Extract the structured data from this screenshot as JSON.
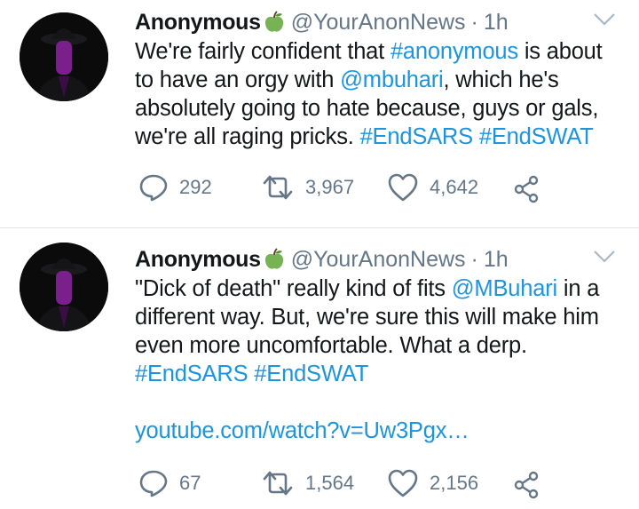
{
  "tweets": [
    {
      "author": "Anonymous",
      "handle": "@YourAnonNews",
      "separator": "·",
      "time": "1h",
      "text": [
        {
          "t": "We're fairly confident that ",
          "link": false
        },
        {
          "t": "#anonymous",
          "link": true
        },
        {
          "t": " is about to have an orgy with ",
          "link": false
        },
        {
          "t": "@mbuhari",
          "link": true
        },
        {
          "t": ", which he's absolutely going to hate because, guys or gals, we're all raging pricks. ",
          "link": false
        },
        {
          "t": "#EndSARS",
          "link": true
        },
        {
          "t": " ",
          "link": false
        },
        {
          "t": "#EndSWAT",
          "link": true
        }
      ],
      "replies": "292",
      "retweets": "3,967",
      "likes": "4,642"
    },
    {
      "author": "Anonymous",
      "handle": "@YourAnonNews",
      "separator": "·",
      "time": "1h",
      "text": [
        {
          "t": "\"Dick of death\" really kind of fits ",
          "link": false
        },
        {
          "t": "@MBuhari",
          "link": true
        },
        {
          "t": " in a different way. But, we're sure this will make him even more uncomfortable. What a derp.",
          "link": false
        },
        {
          "br": true
        },
        {
          "t": "#EndSARS",
          "link": true
        },
        {
          "t": " ",
          "link": false
        },
        {
          "t": "#EndSWAT",
          "link": true
        },
        {
          "br": true
        },
        {
          "br": true
        },
        {
          "t": "youtube.com/watch?v=Uw3Pgx…",
          "link": true
        }
      ],
      "replies": "67",
      "retweets": "1,564",
      "likes": "2,156"
    }
  ],
  "colors": {
    "link": "#1b95e0",
    "secondary_text": "#657786",
    "divider": "#dfe3e6",
    "avatar_accent": "#7a1f8c"
  },
  "icons": [
    "chevron-down-icon",
    "green-apple-emoji-icon",
    "reply-icon",
    "retweet-icon",
    "like-icon",
    "share-icon"
  ]
}
